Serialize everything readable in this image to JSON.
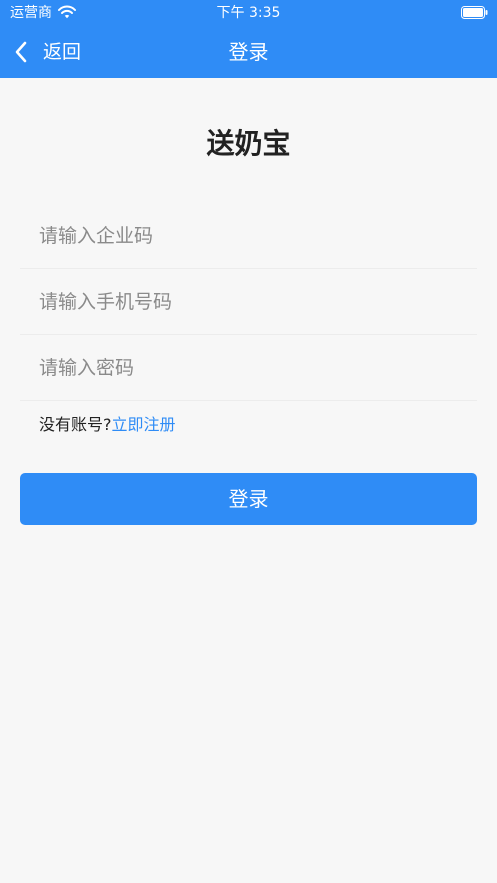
{
  "status_bar": {
    "carrier": "运营商",
    "time": "下午 3:35",
    "wifi_icon": "wifi-icon",
    "battery_icon": "battery-icon"
  },
  "nav": {
    "back_label": "返回",
    "back_icon": "chevron-left-icon",
    "title": "登录"
  },
  "app": {
    "title": "送奶宝"
  },
  "form": {
    "company_code": {
      "value": "",
      "placeholder": "请输入企业码"
    },
    "phone": {
      "value": "",
      "placeholder": "请输入手机号码"
    },
    "password": {
      "value": "",
      "placeholder": "请输入密码"
    }
  },
  "register": {
    "prompt": "没有账号?",
    "link": "立即注册"
  },
  "login_button": {
    "label": "登录"
  },
  "colors": {
    "primary": "#2f8cf6",
    "background": "#f7f7f7",
    "title_text": "#222222",
    "placeholder_text": "#8a8a8a",
    "divider": "#ececec"
  }
}
